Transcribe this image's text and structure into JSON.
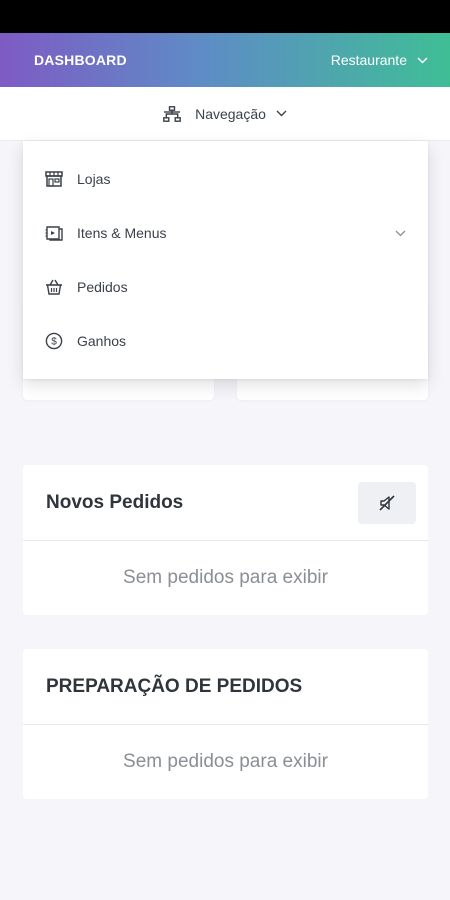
{
  "header": {
    "title": "DASHBOARD",
    "restaurant_label": "Restaurante"
  },
  "navbar": {
    "label": "Navegação"
  },
  "nav_menu": {
    "items": [
      {
        "label": "Lojas",
        "icon": "store-icon"
      },
      {
        "label": "Itens & Menus",
        "icon": "menu-book-icon"
      },
      {
        "label": "Pedidos",
        "icon": "basket-icon"
      },
      {
        "label": "Ganhos",
        "icon": "dollar-circle-icon"
      }
    ]
  },
  "new_orders": {
    "title": "Novos Pedidos",
    "empty": "Sem pedidos para exibir"
  },
  "prep_orders": {
    "title": "PREPARAÇÃO DE PEDIDOS",
    "empty": "Sem pedidos para exibir"
  },
  "colors": {
    "gradient_start": "#7e5bc4",
    "gradient_end": "#3fbe96",
    "background": "#f5f5fa"
  }
}
